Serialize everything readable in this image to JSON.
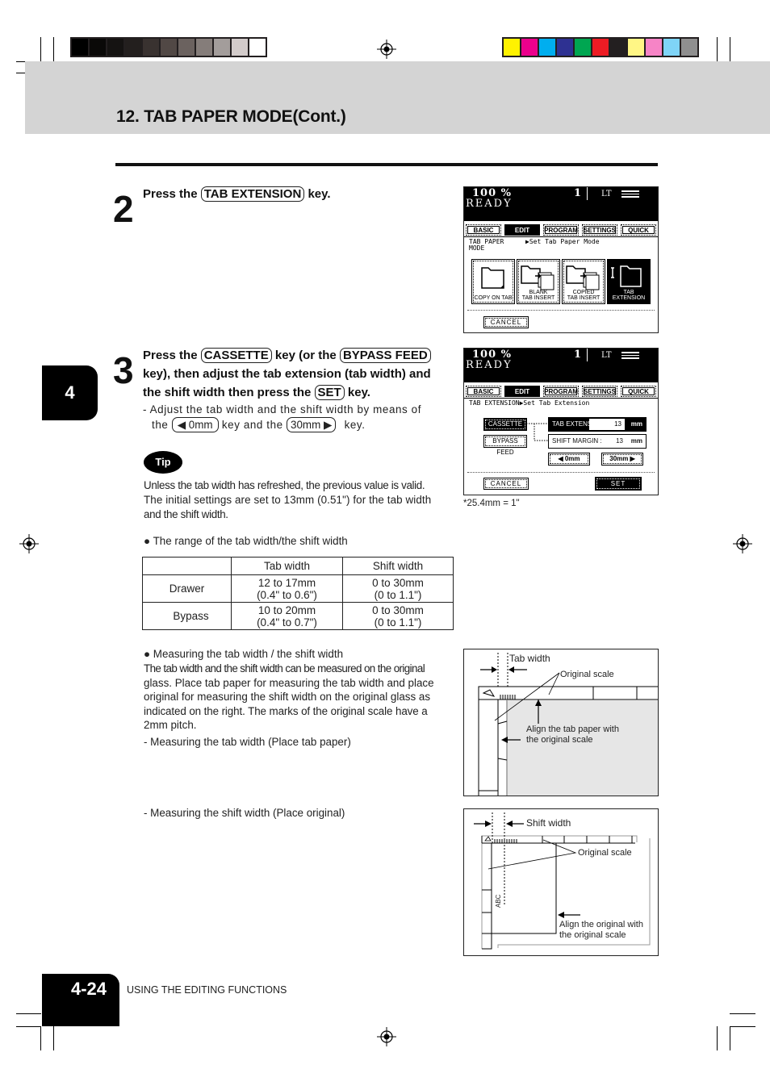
{
  "print_marks": {
    "gray_bar": [
      "#000000",
      "#0a0908",
      "#151312",
      "#231f1e",
      "#393230",
      "#514845",
      "#6b625f",
      "#857d7a",
      "#a39d9b",
      "#d2cbca",
      "#ffffff"
    ],
    "color_bar": [
      "#fff200",
      "#ec008c",
      "#00aeef",
      "#2e3192",
      "#00a651",
      "#ed1c24",
      "#231f20",
      "#fff685",
      "#f684c6",
      "#7fd4f7",
      "#8f8f8f"
    ]
  },
  "header": {
    "title": "12. TAB PAPER MODE(Cont.)"
  },
  "chapter_tab": {
    "number": "4"
  },
  "step2": {
    "number": "2",
    "text_before": "Press the",
    "key": "TAB EXTENSION",
    "text_after": "key."
  },
  "screen1": {
    "zoom": "100  %",
    "count": "1",
    "paper": "LT",
    "status": "READY",
    "tabs": [
      "BASIC",
      "EDIT",
      "PROGRAM",
      "SETTINGS",
      "QUICK"
    ],
    "active_tab": "EDIT",
    "crumb_left": "TAB PAPER\nMODE",
    "crumb_right": "▶Set Tab Paper Mode",
    "buttons": [
      {
        "label": "COPY ON TAB",
        "icon": "folder-icon"
      },
      {
        "label": "BLANK\nTAB INSERT",
        "icon": "tab-insert-icon"
      },
      {
        "label": "COPIED\nTAB INSERT",
        "icon": "tab-insert-icon"
      },
      {
        "label": "TAB\nEXTENSION",
        "icon": "tab-extension-icon"
      }
    ],
    "cancel": "CANCEL"
  },
  "step3": {
    "number": "3",
    "line1_a": "Press the",
    "key_cassette": "CASSETTE",
    "line1_b": "key (or the",
    "key_bypass": "BYPASS FEED",
    "line2": "key), then adjust the tab extension (tab width) and",
    "line3_a": "the shift width then press the",
    "key_set": "SET",
    "line3_b": "key.",
    "sub_a": "-  Adjust the tab width and the shift width by means of",
    "sub_b1": "the",
    "key_0mm": "◀ 0mm",
    "sub_b2": "key and the",
    "key_30mm": "30mm ▶",
    "sub_b3": "key."
  },
  "screen2": {
    "zoom": "100  %",
    "count": "1",
    "paper": "LT",
    "status": "READY",
    "tabs": [
      "BASIC",
      "EDIT",
      "PROGRAM",
      "SETTINGS",
      "QUICK"
    ],
    "active_tab": "EDIT",
    "crumb": "TAB EXTENSION▶Set Tab Extension",
    "cassette": "CASSETTE",
    "bypass": "BYPASS FEED",
    "tab_ext_label": "TAB EXTENSION :",
    "tab_ext_value": "13",
    "shift_label": "SHIFT MARGIN :",
    "shift_value": "13",
    "unit": "mm",
    "btn_0mm": "◀  0mm",
    "btn_30mm": "30mm  ▶",
    "cancel": "CANCEL",
    "set": "SET",
    "note": "*25.4mm = 1\""
  },
  "tip": {
    "badge": "Tip",
    "line1": "Unless the tab width has refreshed, the previous value is valid.",
    "line2": "The initial settings are set to 13mm (0.51\") for the tab width",
    "line3": "and the shift width."
  },
  "range": {
    "heading": "● The range of the tab width/the shift width",
    "columns": [
      "",
      "Tab width",
      "Shift width"
    ],
    "rows": [
      {
        "label": "Drawer",
        "tab": [
          "12 to 17mm",
          "(0.4\" to 0.6\")"
        ],
        "shift": [
          "0 to 30mm",
          "(0 to 1.1\")"
        ]
      },
      {
        "label": "Bypass",
        "tab": [
          "10 to 20mm",
          "(0.4\" to 0.7\")"
        ],
        "shift": [
          "0 to 30mm",
          "(0 to 1.1\")"
        ]
      }
    ]
  },
  "measuring": {
    "heading": "● Measuring the tab width / the shift width",
    "lines": [
      "The tab width and the shift width can be measured on the original",
      "glass. Place tab paper for measuring the tab width and place",
      "original for measuring the shift width on the original glass as",
      "indicated on the right. The marks of the original scale have a",
      "2mm pitch."
    ],
    "tab_sub": "- Measuring the tab width (Place tab paper)",
    "shift_sub": "- Measuring the shift width (Place original)"
  },
  "fig_tab": {
    "label_width": "Tab width",
    "label_scale": "Original scale",
    "align_1": "Align the tab paper with",
    "align_2": "the original scale"
  },
  "fig_shift": {
    "label_width": "Shift width",
    "label_scale": "Original scale",
    "sample": "ABC",
    "align_1": "Align the original with",
    "align_2": "the original scale"
  },
  "footer": {
    "page": "4-24",
    "section": "USING THE EDITING FUNCTIONS"
  }
}
